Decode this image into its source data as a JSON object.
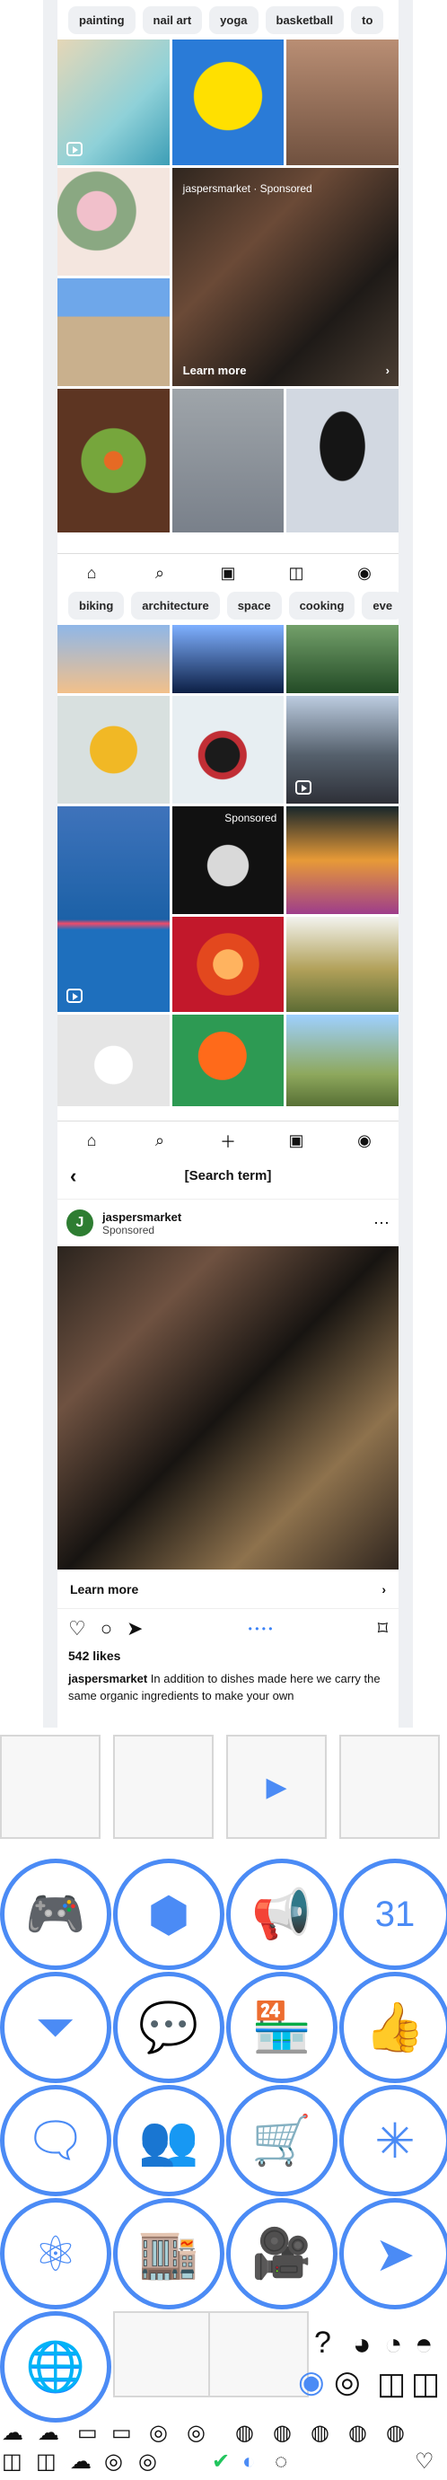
{
  "explore_top": {
    "chips": [
      "painting",
      "nail art",
      "yoga",
      "basketball",
      "to"
    ],
    "sponsor_label": "jaspersmarket · Sponsored",
    "learn_more": "Learn more"
  },
  "explore_mid": {
    "chips": [
      "biking",
      "architecture",
      "space",
      "cooking",
      "eve"
    ],
    "sponsored_badge": "Sponsored"
  },
  "post": {
    "title": "[Search term]",
    "username": "jaspersmarket",
    "sponsored": "Sponsored",
    "learn_more": "Learn more",
    "likes": "542 likes",
    "caption_user": "jaspersmarket",
    "caption_text": " In addition to dishes made here we carry the same organic ingredients to make your own"
  },
  "ui_icons": {
    "frames": [
      "layout-panel-icon",
      "layout-frame-icon",
      "video-play-icon",
      "layout-corner-icon"
    ],
    "circle_icons": [
      "gamepad-icon",
      "cube-icon",
      "megaphone-icon",
      "calendar-check-icon",
      "filter-icon",
      "chat-bubbles-icon",
      "storefront-icon",
      "thumbs-up-icon",
      "message-icon",
      "group-icon",
      "cart-icon",
      "hub-icon",
      "atom-icon",
      "shop-person-icon",
      "video-camera-icon",
      "cursor-icon",
      "globe-icon"
    ],
    "calendar_day": "31",
    "question_mark": "?",
    "glyph_rows": [
      "messenger-icon",
      "threads-icon",
      "whatsapp-icon",
      "facebook-icon",
      "instagram-icon",
      "heart-icon",
      "search-icon",
      "pencil-icon"
    ]
  },
  "colors": {
    "accent_blue": "#4b8bf5",
    "dark": "#111111",
    "light_gray": "#eef0f3"
  }
}
